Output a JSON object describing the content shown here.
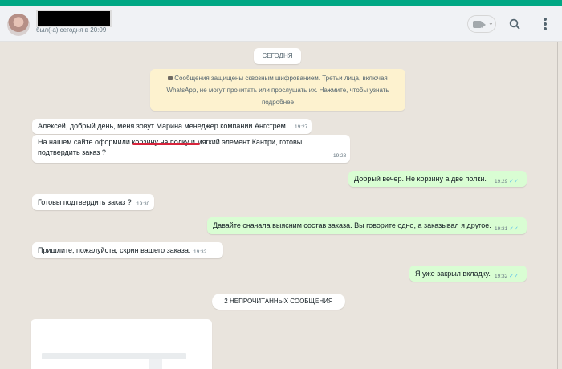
{
  "header": {
    "contact_name": "",
    "status": "был(-а) сегодня в 20:09",
    "video_icon": "video-camera-icon",
    "search_icon": "search-icon",
    "menu_icon": "more-vertical-icon"
  },
  "chat": {
    "date_label": "СЕГОДНЯ",
    "encryption_notice": {
      "line1": "Сообщения защищены сквозным шифрованием. Третьи лица, включая",
      "line2": "WhatsApp, не могут прочитать или прослушать их. Нажмите, чтобы узнать",
      "line3": "подробнее"
    },
    "messages": [
      {
        "direction": "in",
        "lines": [
          "Алексей, добрый день, меня зовут Марина менеджер компании Ангстрем"
        ],
        "time": "19:27"
      },
      {
        "direction": "in",
        "lines": [
          "На нашем сайте оформили корзину на полку и мягкий элемент Кантри, готовы",
          "подтвердить заказ ?"
        ],
        "time": "19:28"
      },
      {
        "direction": "out",
        "lines": [
          "Добрый вечер. Не корзину а две полки."
        ],
        "time": "19:29"
      },
      {
        "direction": "in",
        "lines": [
          "Готовы подтвердить заказ ?"
        ],
        "time": "19:30"
      },
      {
        "direction": "out",
        "lines": [
          "Давайте сначала выясним состав заказа. Вы говорите одно, а заказывал я другое."
        ],
        "time": "19:31"
      },
      {
        "direction": "in",
        "lines": [
          "Пришлите, пожалуйста, скрин вашего заказа."
        ],
        "time": "19:32"
      },
      {
        "direction": "out",
        "lines": [
          "Я уже закрыл вкладку."
        ],
        "time": "19:32"
      }
    ],
    "unread_label": "2 НЕПРОЧИТАННЫХ СООБЩЕНИЯ",
    "read_tick": "✓✓"
  },
  "colors": {
    "accent": "#00a884",
    "incoming_bubble": "#ffffff",
    "outgoing_bubble": "#d9fdd3",
    "read_tick": "#53bdeb",
    "annotation_underline": "#d8243c"
  }
}
